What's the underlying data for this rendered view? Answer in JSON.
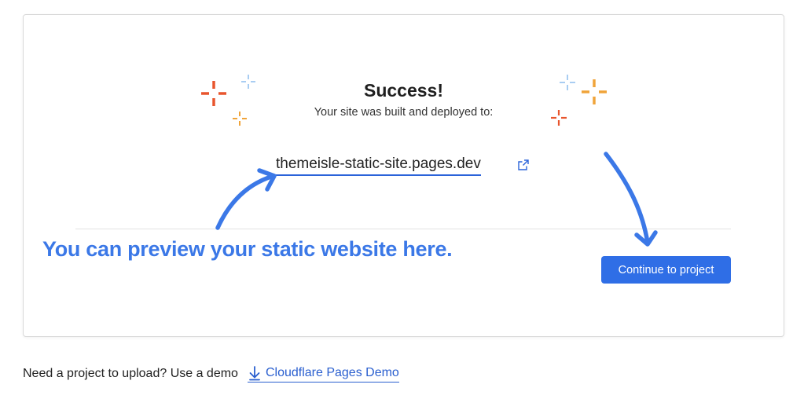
{
  "dialog": {
    "title": "Success!",
    "subtitle": "Your site was built and deployed to:",
    "site_url": "themeisle-static-site.pages.dev",
    "annotation": "You can preview your static website here.",
    "continue_label": "Continue to project"
  },
  "footer": {
    "prompt": "Need a project to upload? Use a demo",
    "demo_link": "Cloudflare Pages Demo"
  },
  "colors": {
    "accent_blue": "#2f6ee6",
    "annotation_blue": "#3b78e7",
    "sparkle_orange": "#e8552d",
    "sparkle_yellow": "#f0a43a",
    "sparkle_lightblue": "#a9cdf2"
  },
  "icons": {
    "external_link": "external-link-icon",
    "download": "download-icon",
    "sparkles": "sparkle-icon"
  }
}
